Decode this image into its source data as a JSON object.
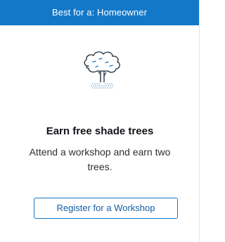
{
  "banner": {
    "text": "Best for a: Homeowner",
    "color": "#1478c8"
  },
  "illustration": {
    "icon": "tree-icon"
  },
  "card": {
    "title": "Earn free shade trees",
    "description": "Attend a workshop and earn two trees.",
    "cta_label": "Register for a Workshop"
  }
}
